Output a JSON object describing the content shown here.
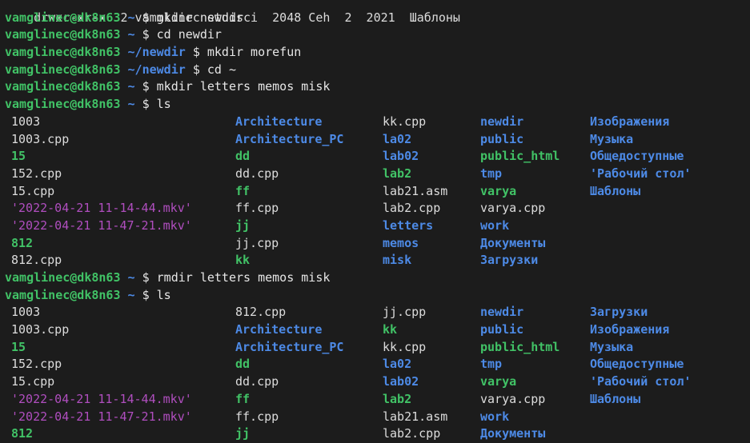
{
  "top_partial": "drwxr-xr-x  2 vamglinec studsci  2048 Ceh  2  2021  Шаблоны",
  "commands": [
    {
      "user": "vamglinec@dk8n63",
      "path": "~",
      "cmd": "mkdir newdir"
    },
    {
      "user": "vamglinec@dk8n63",
      "path": "~",
      "cmd": "cd newdir"
    },
    {
      "user": "vamglinec@dk8n63",
      "path": "~/newdir",
      "cmd": "mkdir morefun"
    },
    {
      "user": "vamglinec@dk8n63",
      "path": "~/newdir",
      "cmd": "cd ~"
    },
    {
      "user": "vamglinec@dk8n63",
      "path": "~",
      "cmd": "mkdir letters memos misk"
    },
    {
      "user": "vamglinec@dk8n63",
      "path": "~",
      "cmd": "ls"
    },
    {
      "user": "vamglinec@dk8n63",
      "path": "~",
      "cmd": "rmdir letters memos misk"
    },
    {
      "user": "vamglinec@dk8n63",
      "path": "~",
      "cmd": "ls"
    }
  ],
  "prompt_symbol": "$",
  "ls1": [
    [
      "1003",
      "Architecture",
      "kk.cpp",
      "newdir",
      "Изображения"
    ],
    [
      "1003.cpp",
      "Architecture_PC",
      "la02",
      "public",
      "Музыка"
    ],
    [
      "15",
      "dd",
      "lab02",
      "public_html",
      "Общедоступные"
    ],
    [
      "152.cpp",
      "dd.cpp",
      "lab2",
      "tmp",
      "'Рабочий стол'"
    ],
    [
      "15.cpp",
      "ff",
      "lab21.asm",
      "varya",
      "Шаблоны"
    ],
    [
      "'2022-04-21 11-14-44.mkv'",
      "ff.cpp",
      "lab2.cpp",
      "varya.cpp",
      ""
    ],
    [
      "'2022-04-21 11-47-21.mkv'",
      "jj",
      "letters",
      "work",
      ""
    ],
    [
      "812",
      "jj.cpp",
      "memos",
      "Документы",
      ""
    ],
    [
      "812.cpp",
      "kk",
      "misk",
      "Загрузки",
      ""
    ]
  ],
  "ls2": [
    [
      "1003",
      "812.cpp",
      "jj.cpp",
      "newdir",
      "Загрузки"
    ],
    [
      "1003.cpp",
      "Architecture",
      "kk",
      "public",
      "Изображения"
    ],
    [
      "15",
      "Architecture_PC",
      "kk.cpp",
      "public_html",
      "Музыка"
    ],
    [
      "152.cpp",
      "dd",
      "la02",
      "tmp",
      "Общедоступные"
    ],
    [
      "15.cpp",
      "dd.cpp",
      "lab02",
      "varya",
      "'Рабочий стол'"
    ],
    [
      "'2022-04-21 11-14-44.mkv'",
      "ff",
      "lab2",
      "varya.cpp",
      "Шаблоны"
    ],
    [
      "'2022-04-21 11-47-21.mkv'",
      "ff.cpp",
      "lab21.asm",
      "work",
      ""
    ],
    [
      "812",
      "jj",
      "lab2.cpp",
      "Документы",
      ""
    ]
  ],
  "colors": {
    "background": "#1c1c1c",
    "user": "#41c266",
    "path": "#4d8ae6",
    "file": "#dcdcdc",
    "directory": "#4d8ae6",
    "other_writable": "#41c266",
    "media": "#b04ebf"
  }
}
